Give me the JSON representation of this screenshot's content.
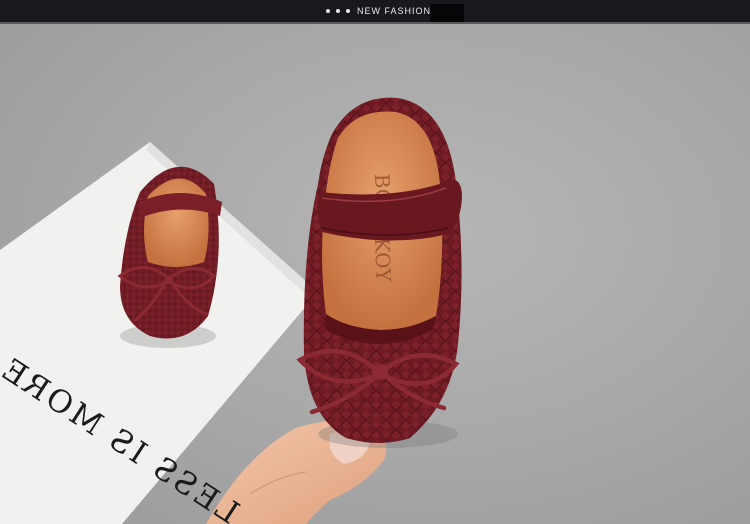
{
  "banner": {
    "dot_count": 3,
    "title": "NEW FASHION",
    "background_color": "#17191f"
  },
  "photo": {
    "paper_text": "LESS IS MORE",
    "colors": {
      "shoe": "#6e1a22",
      "lining": "#d98a55",
      "paper": "#f1f1ef",
      "floor": "#a9a9a9"
    }
  }
}
